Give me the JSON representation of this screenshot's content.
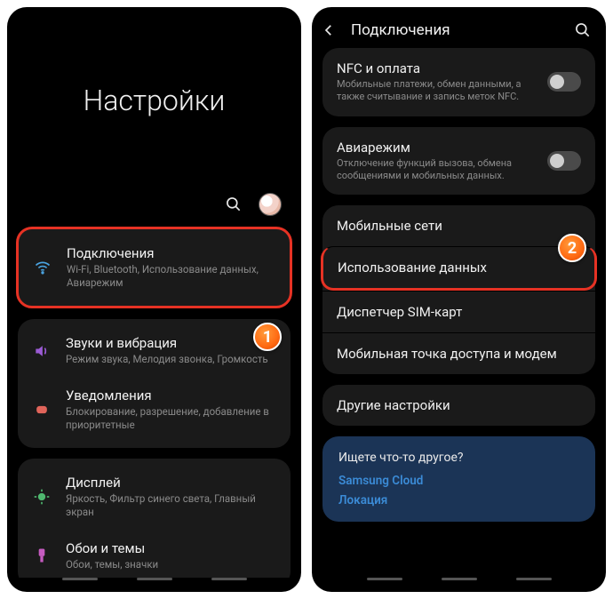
{
  "left": {
    "title": "Настройки",
    "stepBadge": "1",
    "groups": [
      {
        "highlight": true,
        "rows": [
          {
            "icon": "wifi",
            "title": "Подключения",
            "sub": "Wi-Fi, Bluetooth, Использование данных, Авиарежим"
          }
        ]
      },
      {
        "rows": [
          {
            "icon": "sound",
            "title": "Звуки и вибрация",
            "sub": "Режим звука, Мелодия звонка, Громкость"
          },
          {
            "icon": "notif",
            "title": "Уведомления",
            "sub": "Блокирование, разрешение, добавление в приоритетные"
          }
        ]
      },
      {
        "rows": [
          {
            "icon": "display",
            "title": "Дисплей",
            "sub": "Яркость, Фильтр синего света, Главный экран"
          },
          {
            "icon": "theme",
            "title": "Обои и темы",
            "sub": "Обои, темы, значки"
          }
        ]
      }
    ]
  },
  "right": {
    "header": "Подключения",
    "stepBadge": "2",
    "cards": [
      {
        "rows": [
          {
            "title": "NFC и оплата",
            "sub": "Мобильные платежи, обмен данными, а также считывание и запись меток NFC.",
            "toggle": true
          }
        ]
      },
      {
        "rows": [
          {
            "title": "Авиарежим",
            "sub": "Отключение функций вызова, обмена сообщениями и мобильных данных.",
            "toggle": true
          }
        ]
      },
      {
        "rows": [
          {
            "title": "Мобильные сети"
          },
          {
            "title": "Использование данных",
            "highlight": true
          },
          {
            "title": "Диспетчер SIM-карт"
          },
          {
            "title": "Мобильная точка доступа и модем"
          }
        ]
      },
      {
        "rows": [
          {
            "title": "Другие настройки"
          }
        ]
      }
    ],
    "suggest": {
      "question": "Ищете что-то другое?",
      "links": [
        "Samsung Cloud",
        "Локация"
      ]
    }
  }
}
